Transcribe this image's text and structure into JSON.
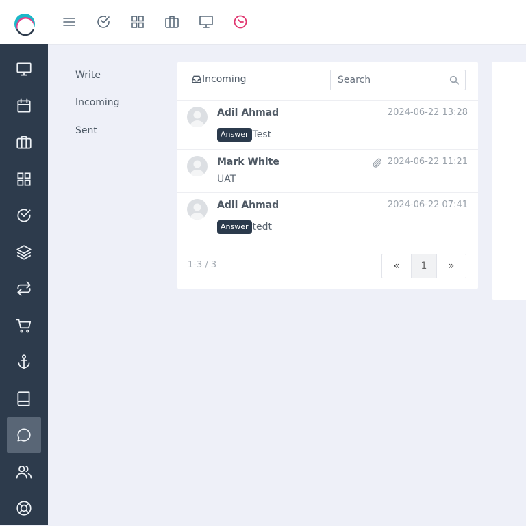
{
  "submenu": {
    "items": [
      {
        "label": "Write"
      },
      {
        "label": "Incoming"
      },
      {
        "label": "Sent"
      }
    ]
  },
  "mailbox": {
    "title": "Incoming",
    "search": {
      "placeholder": "Search",
      "value": ""
    },
    "messages": [
      {
        "sender": "Adil Ahmad",
        "date": "2024-06-22 13:28",
        "badge": "Answer",
        "preview": "Test",
        "attachment": false
      },
      {
        "sender": "Mark White",
        "date": "2024-06-22 11:21",
        "badge": "",
        "preview": "UAT",
        "attachment": true
      },
      {
        "sender": "Adil Ahmad",
        "date": "2024-06-22 07:41",
        "badge": "Answer",
        "preview": "tedt",
        "attachment": false
      }
    ],
    "count": "1-3 / 3",
    "pagination": {
      "prev": "«",
      "current": "1",
      "next": "»"
    }
  },
  "icons": {
    "top": [
      "menu-icon",
      "check-circle-icon",
      "grid-icon",
      "briefcase-icon",
      "monitor-icon",
      "gauge-icon"
    ],
    "sidebar": [
      "monitor-icon",
      "calendar-icon",
      "briefcase-icon",
      "grid-icon",
      "check-circle-icon",
      "layers-icon",
      "repeat-icon",
      "cart-icon",
      "anchor-icon",
      "book-icon",
      "chat-icon",
      "users-icon",
      "lifebuoy-icon"
    ]
  },
  "colors": {
    "sidebar": "#2d3b4c",
    "sidebar_active": "#596676",
    "badge": "#2b3a4c",
    "accent_pink": "#e0356f",
    "background": "#eef0f8"
  }
}
